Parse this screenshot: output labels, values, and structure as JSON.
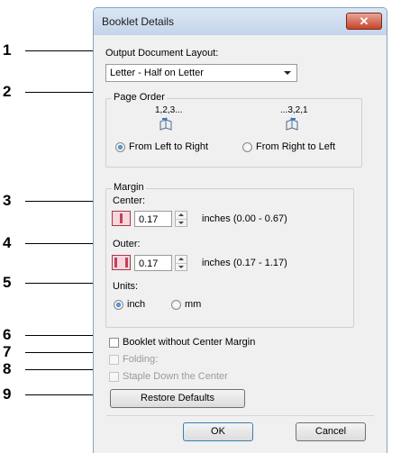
{
  "callouts": [
    "1",
    "2",
    "3",
    "4",
    "5",
    "6",
    "7",
    "8",
    "9"
  ],
  "dialog": {
    "title": "Booklet Details",
    "close": "✕",
    "output_layout_label": "Output Document Layout:",
    "output_layout_value": "Letter - Half on Letter",
    "page_order": {
      "legend": "Page Order",
      "ltr_caption": "1,2,3...",
      "rtl_caption": "...3,2,1",
      "ltr_label": "From Left to Right",
      "rtl_label": "From Right to Left",
      "selected": "ltr"
    },
    "margin": {
      "legend": "Margin",
      "center_label": "Center:",
      "center_value": "0.17",
      "center_range": "inches (0.00 - 0.67)",
      "outer_label": "Outer:",
      "outer_value": "0.17",
      "outer_range": "inches (0.17 - 1.17)",
      "units_label": "Units:",
      "unit_inch": "inch",
      "unit_mm": "mm",
      "selected_unit": "inch"
    },
    "booklet_no_margin": "Booklet without Center Margin",
    "folding": "Folding:",
    "staple": "Staple Down the Center",
    "restore": "Restore Defaults",
    "ok": "OK",
    "cancel": "Cancel"
  },
  "colors": {
    "accent": "#1f5fb0",
    "title_bar": "#c4d5ea",
    "close": "#c7432b"
  }
}
